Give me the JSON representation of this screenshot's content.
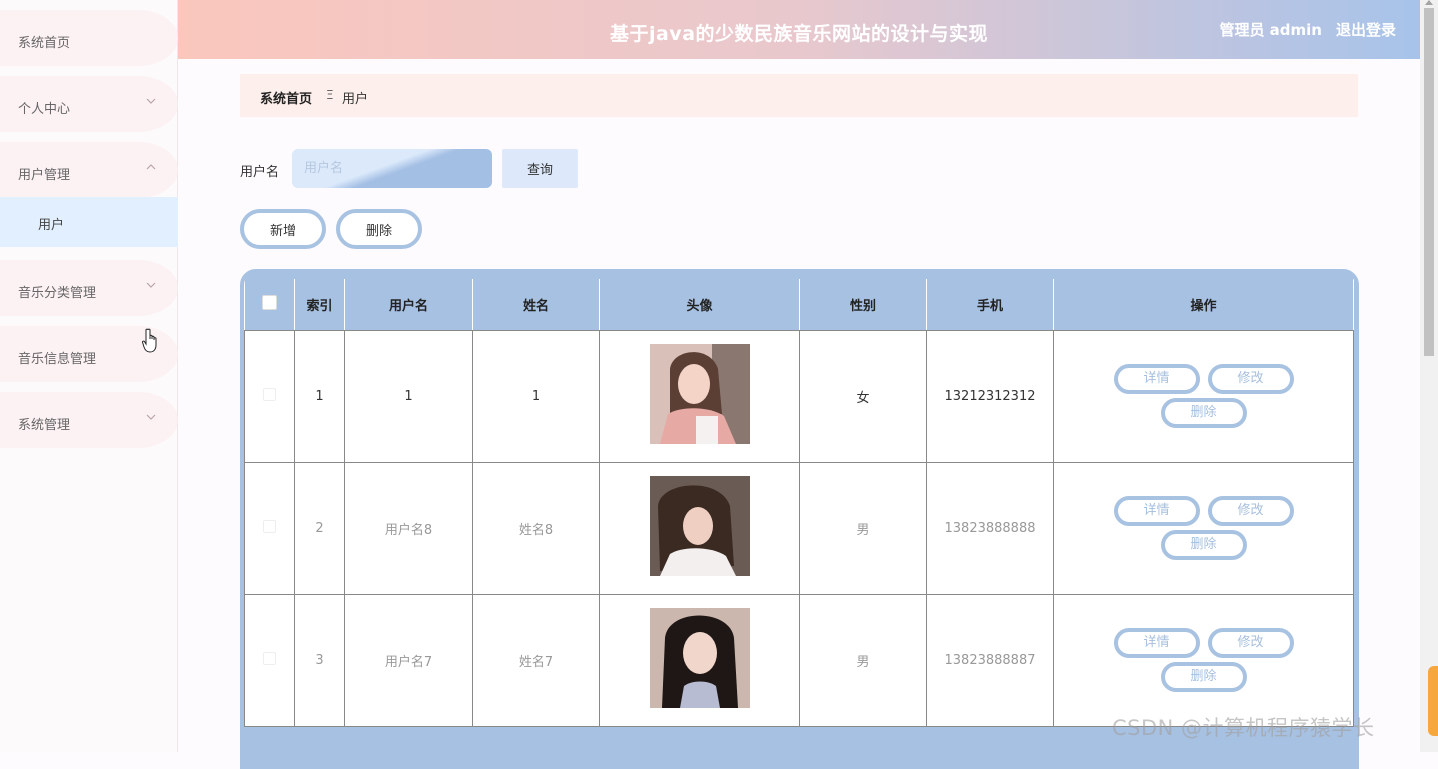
{
  "header": {
    "title": "基于java的少数民族音乐网站的设计与实现",
    "admin_label": "管理员 admin",
    "logout_label": "退出登录"
  },
  "sidebar": {
    "items": [
      {
        "label": "系统首页",
        "has_chevron": false
      },
      {
        "label": "个人中心",
        "has_chevron": true,
        "chevron": "chevron-down-icon"
      },
      {
        "label": "用户管理",
        "has_chevron": true,
        "chevron": "chevron-up-icon"
      },
      {
        "label": "音乐分类管理",
        "has_chevron": true,
        "chevron": "chevron-down-icon"
      },
      {
        "label": "音乐信息管理",
        "has_chevron": false
      },
      {
        "label": "系统管理",
        "has_chevron": true,
        "chevron": "chevron-down-icon"
      }
    ],
    "sub_item": "用户"
  },
  "breadcrumb": {
    "home": "系统首页",
    "separator": "Ξ",
    "current": "用户"
  },
  "search": {
    "label": "用户名",
    "placeholder": "用户名",
    "value": "",
    "button": "查询"
  },
  "toolbar": {
    "add_label": "新增",
    "delete_label": "删除"
  },
  "table": {
    "columns": [
      "索引",
      "用户名",
      "姓名",
      "头像",
      "性别",
      "手机",
      "操作"
    ],
    "rows": [
      {
        "index": "1",
        "username": "1",
        "name": "1",
        "gender": "女",
        "phone": "13212312312"
      },
      {
        "index": "2",
        "username": "用户名8",
        "name": "姓名8",
        "gender": "男",
        "phone": "13823888888"
      },
      {
        "index": "3",
        "username": "用户名7",
        "name": "姓名7",
        "gender": "男",
        "phone": "13823888887"
      }
    ],
    "actions": {
      "detail": "详情",
      "edit": "修改",
      "delete": "删除"
    }
  },
  "watermark": "CSDN @计算机程序猿学长",
  "colors": {
    "accent": "#a7c1e2",
    "header_start": "#fbc7bd",
    "header_end": "#a7c3ea",
    "breadcrumb_bg": "#fdf0ec",
    "sidebar_active": "#e1efff",
    "float_button": "#f6a73e"
  }
}
